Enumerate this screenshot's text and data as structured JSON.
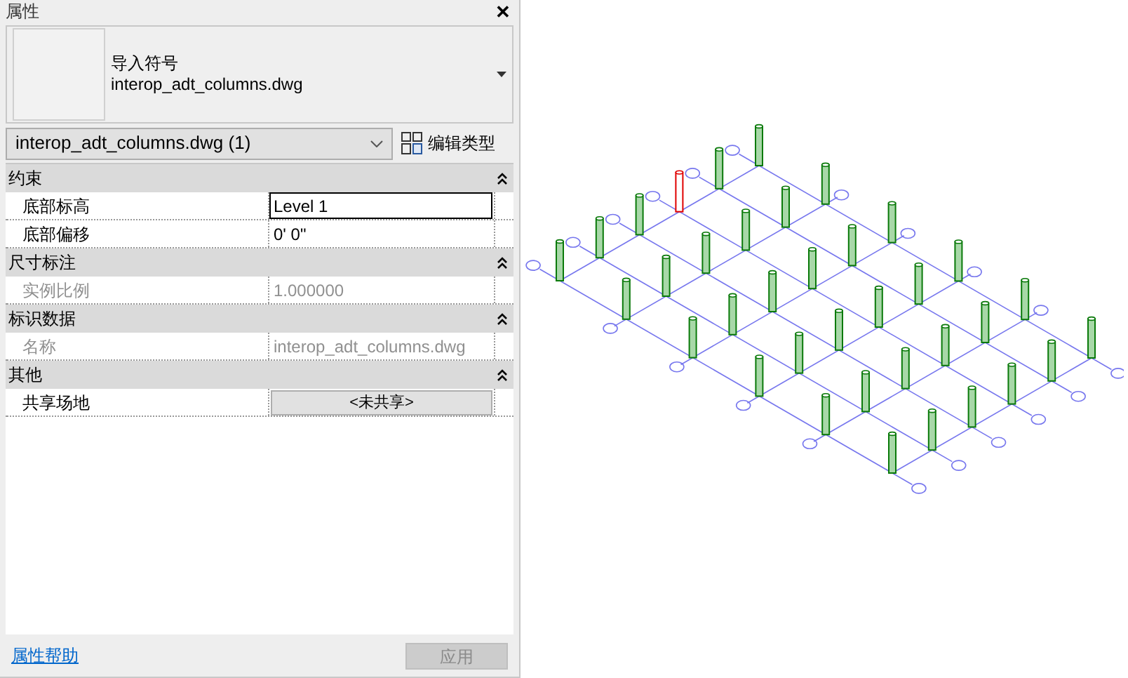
{
  "panel": {
    "title": "属性",
    "close": "✕"
  },
  "type_selector": {
    "category": "导入符号",
    "name": "interop_adt_columns.dwg"
  },
  "instance_selector": {
    "value": "interop_adt_columns.dwg (1)"
  },
  "edit_type_button": {
    "label": "编辑类型"
  },
  "groups": [
    {
      "title": "约束",
      "expanded": true,
      "properties": [
        {
          "label": "底部标高",
          "value": "Level 1",
          "kind": "text",
          "disabled": false,
          "selected": true
        },
        {
          "label": "底部偏移",
          "value": "0'  0\"",
          "kind": "text",
          "disabled": false,
          "selected": false
        }
      ]
    },
    {
      "title": "尺寸标注",
      "expanded": true,
      "properties": [
        {
          "label": "实例比例",
          "value": "1.000000",
          "kind": "text",
          "disabled": true,
          "selected": false
        }
      ]
    },
    {
      "title": "标识数据",
      "expanded": true,
      "properties": [
        {
          "label": "名称",
          "value": "interop_adt_columns.dwg",
          "kind": "text",
          "disabled": true,
          "selected": false
        }
      ]
    },
    {
      "title": "其他",
      "expanded": true,
      "properties": [
        {
          "label": "共享场地",
          "value": "<未共享>",
          "kind": "button",
          "disabled": false,
          "selected": false
        }
      ]
    }
  ],
  "help_link": "属性帮助",
  "apply_button": {
    "label": "应用",
    "disabled": true
  }
}
